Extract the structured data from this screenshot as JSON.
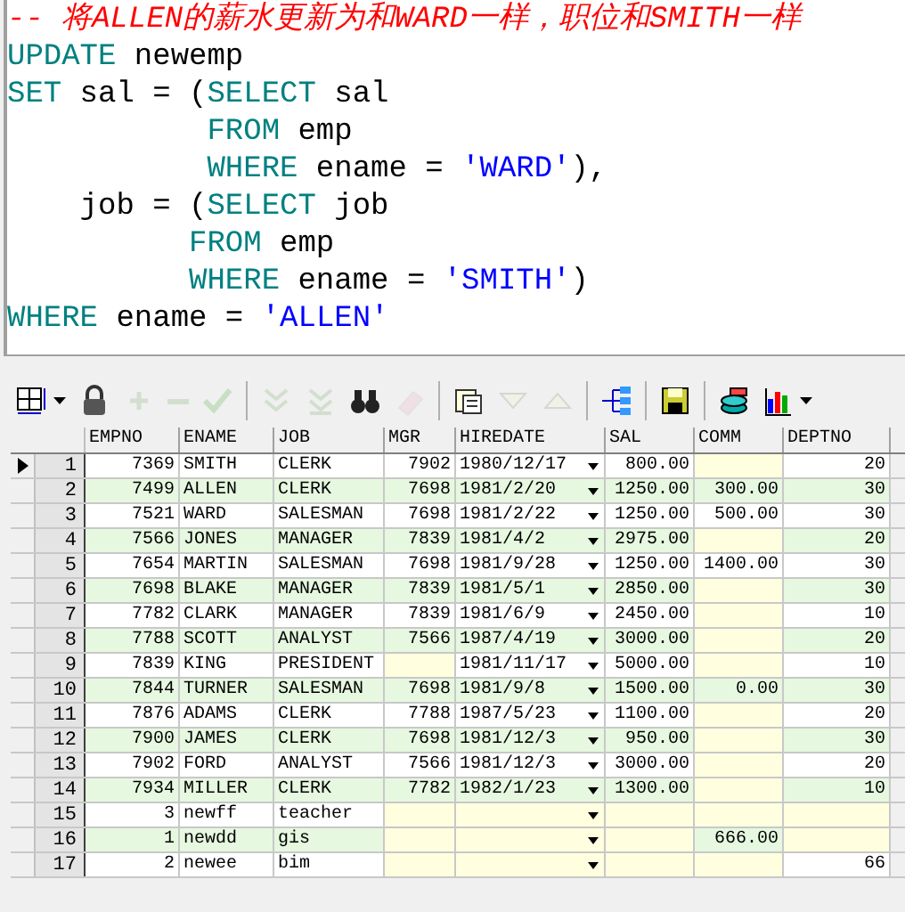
{
  "editor": {
    "lines": [
      [
        {
          "kind": "comment",
          "text": "-- 将ALLEN的薪水更新为和WARD一样，职位和SMITH一样"
        }
      ],
      [
        {
          "kind": "keyword",
          "text": "UPDATE"
        },
        {
          "kind": "plain",
          "text": " newemp"
        }
      ],
      [
        {
          "kind": "keyword",
          "text": "SET"
        },
        {
          "kind": "plain",
          "text": " sal = ("
        },
        {
          "kind": "keyword",
          "text": "SELECT"
        },
        {
          "kind": "plain",
          "text": " sal"
        }
      ],
      [
        {
          "kind": "keyword",
          "text": "           FROM"
        },
        {
          "kind": "plain",
          "text": " emp"
        }
      ],
      [
        {
          "kind": "keyword",
          "text": "           WHERE"
        },
        {
          "kind": "plain",
          "text": " ename = "
        },
        {
          "kind": "string",
          "text": "'WARD'"
        },
        {
          "kind": "plain",
          "text": "),"
        }
      ],
      [
        {
          "kind": "plain",
          "text": "    job = ("
        },
        {
          "kind": "keyword",
          "text": "SELECT"
        },
        {
          "kind": "plain",
          "text": " job"
        }
      ],
      [
        {
          "kind": "keyword",
          "text": "          FROM"
        },
        {
          "kind": "plain",
          "text": " emp"
        }
      ],
      [
        {
          "kind": "keyword",
          "text": "          WHERE"
        },
        {
          "kind": "plain",
          "text": " ename = "
        },
        {
          "kind": "string",
          "text": "'SMITH'"
        },
        {
          "kind": "plain",
          "text": ")"
        }
      ],
      [
        {
          "kind": "keyword",
          "text": "WHERE"
        },
        {
          "kind": "plain",
          "text": " ename = "
        },
        {
          "kind": "string",
          "text": "'ALLEN'"
        }
      ]
    ]
  },
  "toolbar": [
    {
      "kind": "grid",
      "disabled": false,
      "dropdown": true
    },
    {
      "kind": "lock",
      "disabled": false,
      "dropdown": false
    },
    {
      "kind": "plus",
      "disabled": true,
      "dropdown": false
    },
    {
      "kind": "minus",
      "disabled": true,
      "dropdown": false
    },
    {
      "kind": "check",
      "disabled": true,
      "dropdown": false
    },
    {
      "kind": "separator"
    },
    {
      "kind": "chevrons",
      "disabled": true,
      "dropdown": false
    },
    {
      "kind": "chevrons-bar",
      "disabled": true,
      "dropdown": false
    },
    {
      "kind": "binoculars",
      "disabled": false,
      "dropdown": false
    },
    {
      "kind": "eraser",
      "disabled": true,
      "dropdown": false
    },
    {
      "kind": "separator"
    },
    {
      "kind": "notes",
      "disabled": false,
      "dropdown": false
    },
    {
      "kind": "down",
      "disabled": true,
      "dropdown": false
    },
    {
      "kind": "up",
      "disabled": true,
      "dropdown": false
    },
    {
      "kind": "separator"
    },
    {
      "kind": "tree",
      "disabled": false,
      "dropdown": false
    },
    {
      "kind": "separator"
    },
    {
      "kind": "save",
      "disabled": false,
      "dropdown": false
    },
    {
      "kind": "separator"
    },
    {
      "kind": "database",
      "disabled": false,
      "dropdown": false
    },
    {
      "kind": "chart",
      "disabled": false,
      "dropdown": true
    }
  ],
  "table": {
    "columns": [
      "EMPNO",
      "ENAME",
      "JOB",
      "MGR",
      "HIREDATE",
      "SAL",
      "COMM",
      "DEPTNO"
    ],
    "rows": [
      {
        "row": "1",
        "current": true,
        "cells": [
          "7369",
          "SMITH",
          "CLERK",
          "7902",
          "1980/12/17",
          "800.00",
          null,
          "20"
        ]
      },
      {
        "row": "2",
        "current": false,
        "cells": [
          "7499",
          "ALLEN",
          "CLERK",
          "7698",
          "1981/2/20",
          "1250.00",
          "300.00",
          "30"
        ]
      },
      {
        "row": "3",
        "current": false,
        "cells": [
          "7521",
          "WARD",
          "SALESMAN",
          "7698",
          "1981/2/22",
          "1250.00",
          "500.00",
          "30"
        ]
      },
      {
        "row": "4",
        "current": false,
        "cells": [
          "7566",
          "JONES",
          "MANAGER",
          "7839",
          "1981/4/2",
          "2975.00",
          null,
          "20"
        ]
      },
      {
        "row": "5",
        "current": false,
        "cells": [
          "7654",
          "MARTIN",
          "SALESMAN",
          "7698",
          "1981/9/28",
          "1250.00",
          "1400.00",
          "30"
        ]
      },
      {
        "row": "6",
        "current": false,
        "cells": [
          "7698",
          "BLAKE",
          "MANAGER",
          "7839",
          "1981/5/1",
          "2850.00",
          null,
          "30"
        ]
      },
      {
        "row": "7",
        "current": false,
        "cells": [
          "7782",
          "CLARK",
          "MANAGER",
          "7839",
          "1981/6/9",
          "2450.00",
          null,
          "10"
        ]
      },
      {
        "row": "8",
        "current": false,
        "cells": [
          "7788",
          "SCOTT",
          "ANALYST",
          "7566",
          "1987/4/19",
          "3000.00",
          null,
          "20"
        ]
      },
      {
        "row": "9",
        "current": false,
        "cells": [
          "7839",
          "KING",
          "PRESIDENT",
          null,
          "1981/11/17",
          "5000.00",
          null,
          "10"
        ]
      },
      {
        "row": "10",
        "current": false,
        "cells": [
          "7844",
          "TURNER",
          "SALESMAN",
          "7698",
          "1981/9/8",
          "1500.00",
          "0.00",
          "30"
        ]
      },
      {
        "row": "11",
        "current": false,
        "cells": [
          "7876",
          "ADAMS",
          "CLERK",
          "7788",
          "1987/5/23",
          "1100.00",
          null,
          "20"
        ]
      },
      {
        "row": "12",
        "current": false,
        "cells": [
          "7900",
          "JAMES",
          "CLERK",
          "7698",
          "1981/12/3",
          "950.00",
          null,
          "30"
        ]
      },
      {
        "row": "13",
        "current": false,
        "cells": [
          "7902",
          "FORD",
          "ANALYST",
          "7566",
          "1981/12/3",
          "3000.00",
          null,
          "20"
        ]
      },
      {
        "row": "14",
        "current": false,
        "cells": [
          "7934",
          "MILLER",
          "CLERK",
          "7782",
          "1982/1/23",
          "1300.00",
          null,
          "10"
        ]
      },
      {
        "row": "15",
        "current": false,
        "cells": [
          "3",
          "newff",
          "teacher",
          null,
          null,
          null,
          null,
          null
        ]
      },
      {
        "row": "16",
        "current": false,
        "cells": [
          "1",
          "newdd",
          "gis",
          null,
          null,
          null,
          "666.00",
          null
        ]
      },
      {
        "row": "17",
        "current": false,
        "cells": [
          "2",
          "newee",
          "bim",
          null,
          null,
          null,
          null,
          "66"
        ]
      }
    ]
  }
}
